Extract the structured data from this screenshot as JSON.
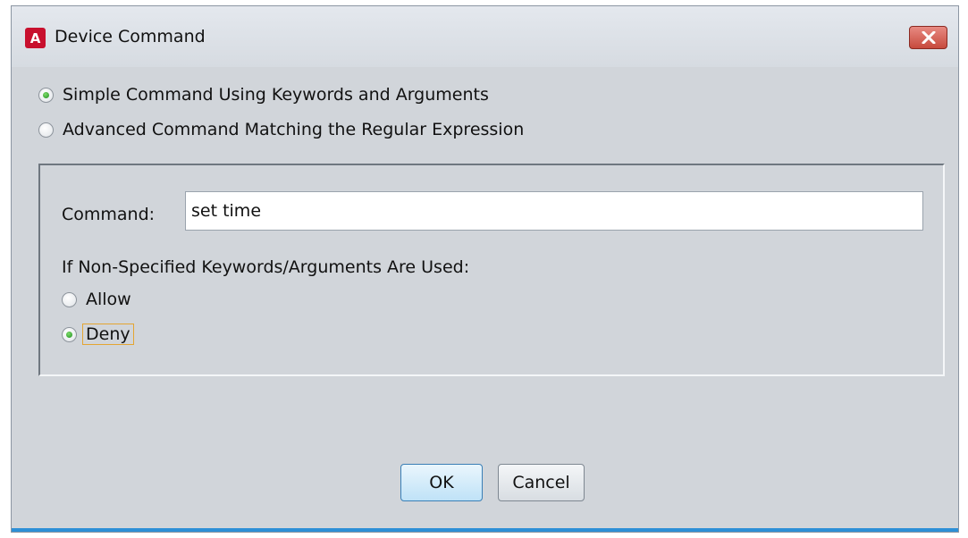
{
  "window": {
    "title": "Device Command",
    "app_icon_letter": "A",
    "close_icon": "close-x-icon"
  },
  "mode": {
    "options": [
      {
        "label": "Simple Command Using Keywords and Arguments",
        "checked": true
      },
      {
        "label": "Advanced Command Matching the Regular Expression",
        "checked": false
      }
    ]
  },
  "command": {
    "label": "Command:",
    "value": "set time"
  },
  "policy": {
    "label": "If Non-Specified Keywords/Arguments Are Used:",
    "options": [
      {
        "label": "Allow",
        "checked": false
      },
      {
        "label": "Deny",
        "checked": true
      }
    ]
  },
  "buttons": {
    "ok": "OK",
    "cancel": "Cancel"
  },
  "colors": {
    "app_icon": "#c8102e",
    "close_button": "#c74a3d",
    "radio_checked": "#1f8f1f",
    "focus_outline": "#e4a532",
    "default_button_border": "#3a7fb6"
  }
}
